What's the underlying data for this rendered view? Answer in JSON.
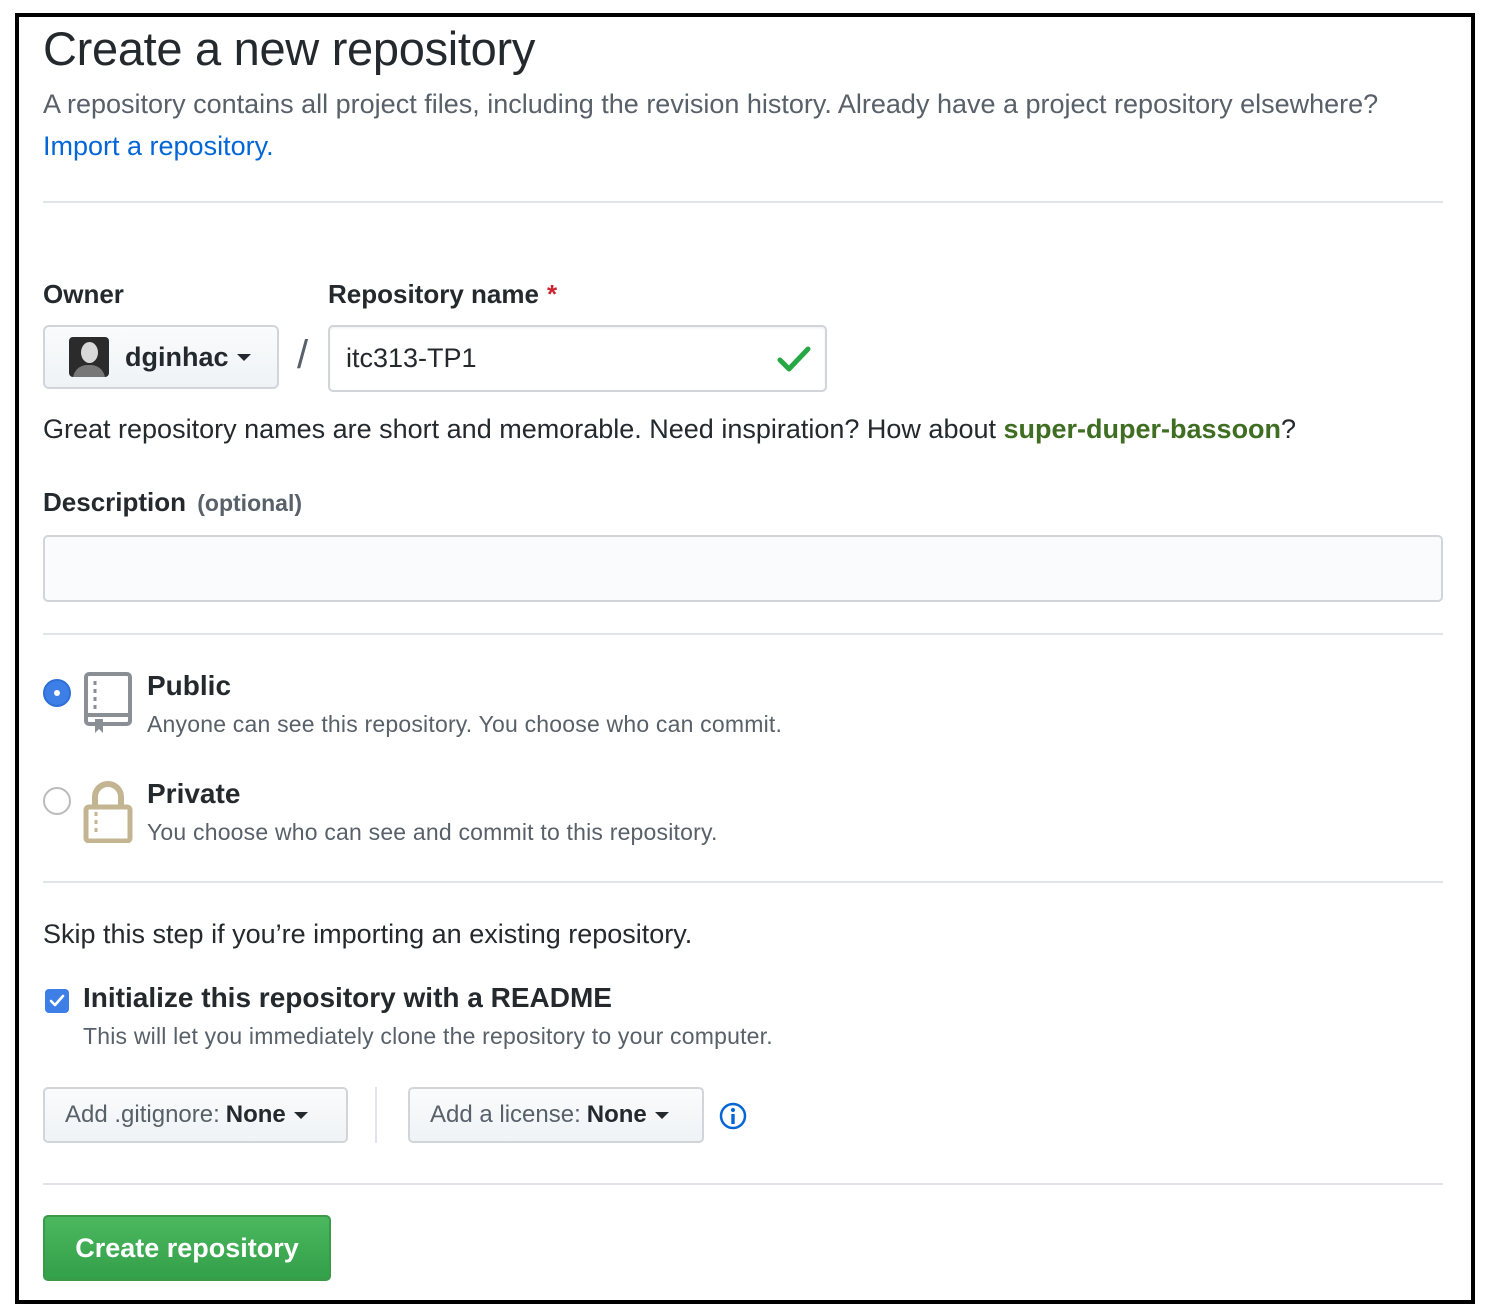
{
  "header": {
    "title": "Create a new repository",
    "subtitle": "A repository contains all project files, including the revision history. Already have a project repository elsewhere?",
    "import_link": "Import a repository."
  },
  "owner": {
    "label": "Owner",
    "value": "dginhac"
  },
  "repository_name": {
    "label": "Repository name",
    "required_mark": "*",
    "value": "itc313-TP1",
    "separator": "/"
  },
  "hint": {
    "text": "Great repository names are short and memorable. Need inspiration? How about",
    "suggestion": "super-duper-bassoon",
    "suffix": "?"
  },
  "description": {
    "label": "Description",
    "optional": "(optional)",
    "value": "",
    "placeholder": ""
  },
  "visibility": {
    "public": {
      "title": "Public",
      "description": "Anyone can see this repository. You choose who can commit.",
      "selected": true
    },
    "private": {
      "title": "Private",
      "description": "You choose who can see and commit to this repository.",
      "selected": false
    }
  },
  "init": {
    "skip_text": "Skip this step if you’re importing an existing repository.",
    "readme_label": "Initialize this repository with a README",
    "readme_desc": "This will let you immediately clone the repository to your computer.",
    "readme_checked": true
  },
  "gitignore": {
    "label": "Add .gitignore:",
    "value": "None"
  },
  "license": {
    "label": "Add a license:",
    "value": "None"
  },
  "create_button": "Create repository",
  "colors": {
    "link": "#0366d6",
    "suggestion": "#3f6e23",
    "primary_button": "#3fa955",
    "radio_checked": "#3d7fe6",
    "required": "#cb2431"
  },
  "icons": [
    "check-icon",
    "caret-down-icon",
    "repo-book-icon",
    "lock-icon",
    "checkbox-check-icon",
    "info-icon"
  ]
}
